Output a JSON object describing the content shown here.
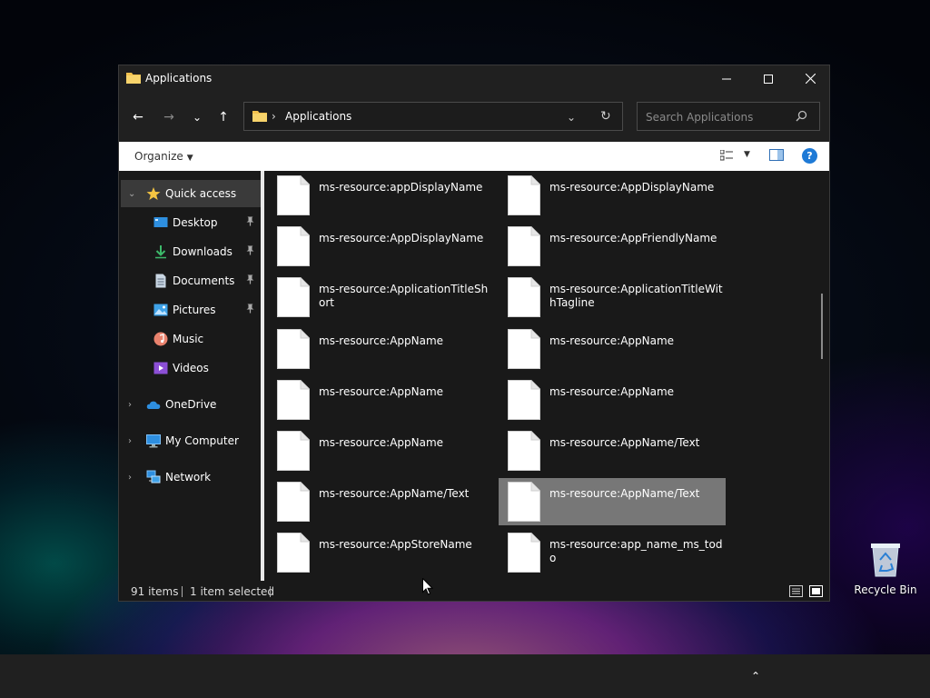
{
  "window": {
    "title": "Applications",
    "controls": {
      "minimize": "—",
      "maximize": "☐",
      "close": "✕"
    }
  },
  "nav": {
    "back": "←",
    "forward": "→",
    "recent": "⌄",
    "up": "↑",
    "address": {
      "separator": "›",
      "path": "Applications",
      "dropdown": "⌄",
      "refresh": "↻"
    },
    "search": {
      "placeholder": "Search Applications"
    }
  },
  "commandbar": {
    "organize": "Organize",
    "organize_arrow": "▼",
    "view_dropdown": "▼",
    "help": "?"
  },
  "sidebar": {
    "items": [
      {
        "label": "Quick access",
        "icon": "star-icon",
        "expander": "⌄",
        "pinned": false,
        "selected": true
      },
      {
        "label": "Desktop",
        "icon": "desktop-icon",
        "expander": "",
        "pinned": true,
        "selected": false
      },
      {
        "label": "Downloads",
        "icon": "download-icon",
        "expander": "",
        "pinned": true,
        "selected": false
      },
      {
        "label": "Documents",
        "icon": "document-icon",
        "expander": "",
        "pinned": true,
        "selected": false
      },
      {
        "label": "Pictures",
        "icon": "pictures-icon",
        "expander": "",
        "pinned": true,
        "selected": false
      },
      {
        "label": "Music",
        "icon": "music-icon",
        "expander": "",
        "pinned": false,
        "selected": false
      },
      {
        "label": "Videos",
        "icon": "videos-icon",
        "expander": "",
        "pinned": false,
        "selected": false
      },
      {
        "label": "OneDrive",
        "icon": "cloud-icon",
        "expander": "›",
        "pinned": false,
        "selected": false
      },
      {
        "label": "My Computer",
        "icon": "computer-icon",
        "expander": "›",
        "pinned": false,
        "selected": false
      },
      {
        "label": "Network",
        "icon": "network-icon",
        "expander": "›",
        "pinned": false,
        "selected": false
      }
    ],
    "pin_glyph": "📌"
  },
  "files": [
    {
      "name": "ms-resource:appDisplayName",
      "selected": false
    },
    {
      "name": "ms-resource:AppDisplayName",
      "selected": false
    },
    {
      "name": "ms-resource:AppDisplayName",
      "selected": false
    },
    {
      "name": "ms-resource:AppFriendlyName",
      "selected": false
    },
    {
      "name": "ms-resource:ApplicationTitleShort",
      "selected": false
    },
    {
      "name": "ms-resource:ApplicationTitleWithTagline",
      "selected": false
    },
    {
      "name": "ms-resource:AppName",
      "selected": false
    },
    {
      "name": "ms-resource:AppName",
      "selected": false
    },
    {
      "name": "ms-resource:AppName",
      "selected": false
    },
    {
      "name": "ms-resource:AppName",
      "selected": false
    },
    {
      "name": "ms-resource:AppName",
      "selected": false
    },
    {
      "name": "ms-resource:AppName/Text",
      "selected": false
    },
    {
      "name": "ms-resource:AppName/Text",
      "selected": false
    },
    {
      "name": "ms-resource:AppName/Text",
      "selected": true
    },
    {
      "name": "ms-resource:AppStoreName",
      "selected": false
    },
    {
      "name": "ms-resource:app_name_ms_todo",
      "selected": false
    }
  ],
  "status": {
    "items": "91 items",
    "selection": "1 item selected"
  },
  "desktop": {
    "recycle_bin": "Recycle Bin"
  },
  "taskbar": {
    "chevron": "⌃"
  },
  "colors": {
    "accent": "#1e7ad6",
    "folder": "#f2c14e",
    "selection": "#777777",
    "star": "#f5c542"
  }
}
